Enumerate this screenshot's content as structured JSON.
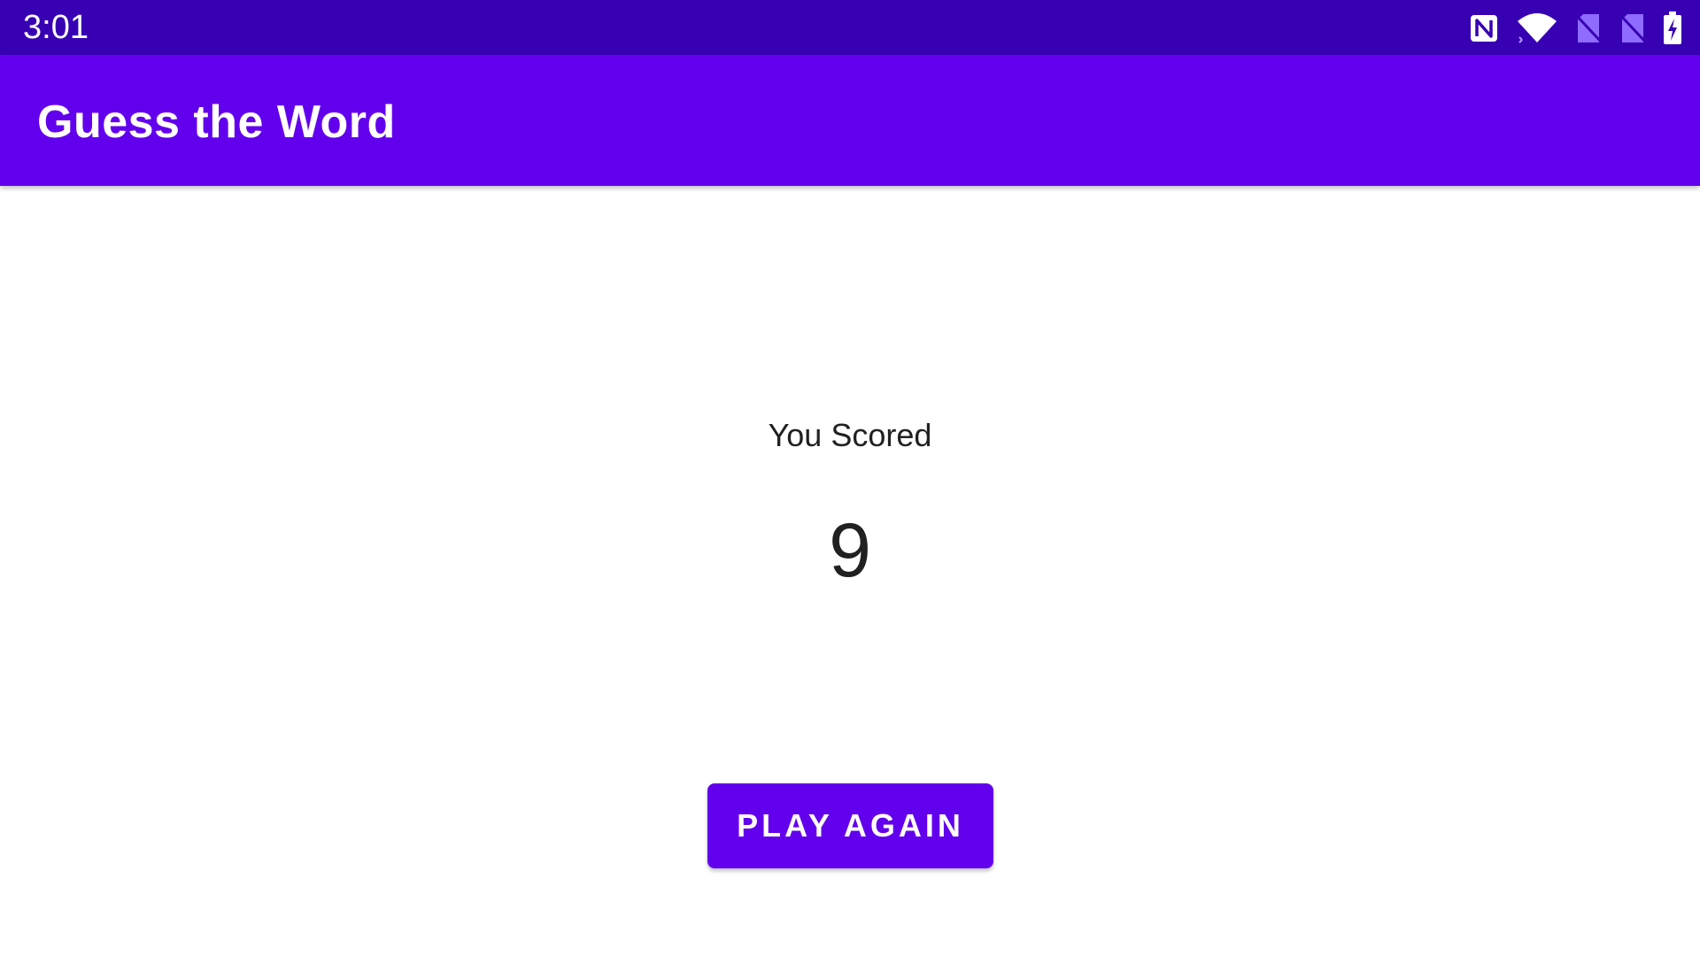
{
  "status_bar": {
    "time": "3:01",
    "icons": [
      "nfc-icon",
      "wifi-icon",
      "no-sim-icon",
      "no-sim-icon",
      "battery-charging-icon"
    ],
    "background": "#3700B3"
  },
  "app_bar": {
    "title": "Guess the Word",
    "background": "#6200EE"
  },
  "score_screen": {
    "label": "You Scored",
    "score": "9",
    "play_again_label": "PLAY AGAIN"
  },
  "colors": {
    "primary": "#6200EE",
    "primary_dark": "#3700B3",
    "text": "#212121"
  }
}
